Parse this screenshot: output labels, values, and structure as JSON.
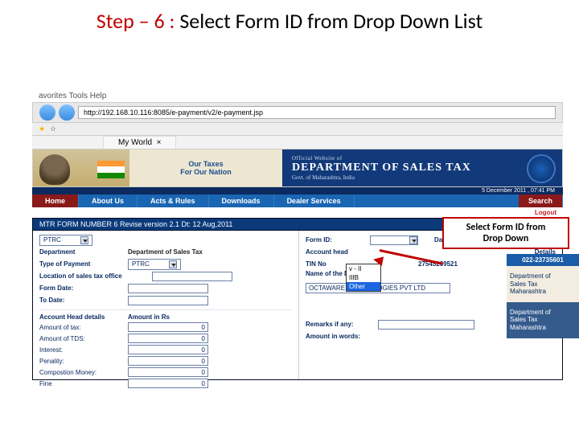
{
  "slide": {
    "prefix": "Step – 6 :",
    "rest": " Select Form ID from Drop Down List"
  },
  "callout": {
    "line1": "Select Form ID from",
    "line2": "Drop Down"
  },
  "browser": {
    "menu": "avorites   Tools   Help",
    "url": "http://192.168.10.116:8085/e-payment/v2/e-payment.jsp",
    "tab": "My World"
  },
  "banner": {
    "tagline1": "Our Taxes",
    "tagline2": "For Our Nation",
    "kicker": "Official Website of",
    "dept": "DEPARTMENT OF SALES TAX",
    "sub": "Govt. of Maharashtra, India",
    "datetime": "5 December 2011 , 07:41 PM"
  },
  "nav": {
    "home": "Home",
    "about": "About Us",
    "acts": "Acts & Rules",
    "downloads": "Downloads",
    "dealer": "Dealer Services",
    "search": "Search"
  },
  "logout": "Logout",
  "form_title": "MTR FORM NUMBER 6 Revise version 2.1 Dt: 12 Aug,2011",
  "left": {
    "ptrc": "PTRC",
    "department_lbl": "Department",
    "department": "Department of Sales Tax",
    "type_lbl": "Type of Payment",
    "type": "PTRC",
    "location_lbl": "Location of sales tax office",
    "form_date_lbl": "Form Date:",
    "to_date_lbl": "To Date:",
    "amount_head_lbl": "Account Head details",
    "amount_rs_lbl": "Amount in Rs",
    "amount_tax_lbl": "Amount of tax:",
    "amount_tds_lbl": "Amount of TDS:",
    "interest_lbl": "Interest:",
    "penalty_lbl": "Penality:",
    "compostion_lbl": "Compostion Money:",
    "fine_lbl": "Fine",
    "zero": "0"
  },
  "right": {
    "formid_lbl": "Form ID:",
    "date_lbl": "Date:",
    "accthead_lbl": "Account head",
    "details_lbl": "Details",
    "tin_lbl": "TIN No",
    "tin": "27545209521",
    "name_lbl": "Name of the Dealer",
    "name": "OCTAWARE TECHNOLOGIES PVT LTD",
    "remarks_lbl": "Remarks if any:",
    "amount_words_lbl": "Amount in words:"
  },
  "dropdown": {
    "opt1": "v - II",
    "opt2": "IIIB",
    "opt3": "Other"
  },
  "side": {
    "phone": "022-23735601",
    "box1a": "Department of",
    "box1b": "Sales Tax",
    "box1c": "Maharashtra",
    "box2a": "Department of",
    "box2b": "Sales Tax",
    "box2c": "Maharashtra"
  }
}
